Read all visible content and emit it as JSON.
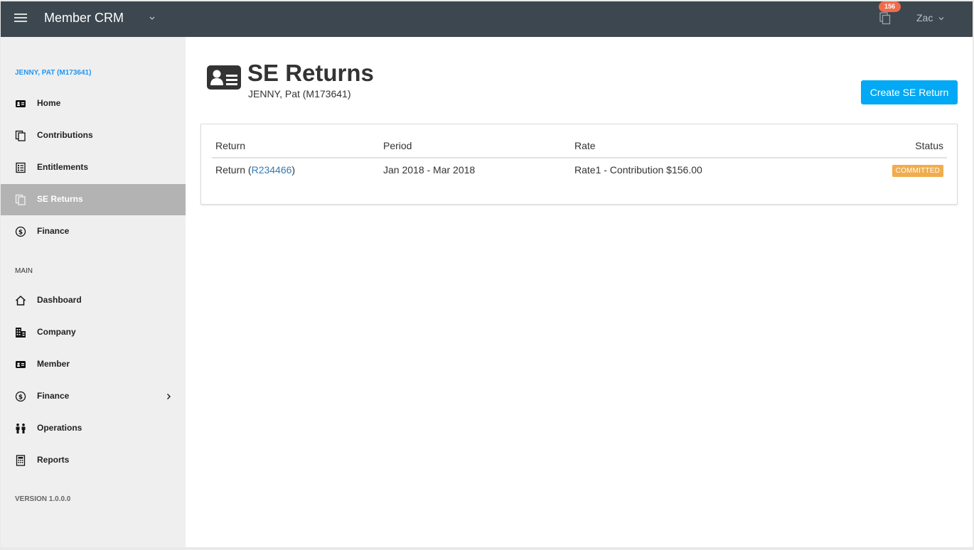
{
  "app": {
    "title": "Member CRM",
    "notification_count": "156",
    "user_name": "Zac"
  },
  "sidebar": {
    "member_label": "JENNY, PAT (M173641)",
    "member_items": [
      {
        "label": "Home",
        "icon": "id-card-icon"
      },
      {
        "label": "Contributions",
        "icon": "copy-icon"
      },
      {
        "label": "Entitlements",
        "icon": "checklist-icon"
      },
      {
        "label": "SE Returns",
        "icon": "copy-icon",
        "active": true
      },
      {
        "label": "Finance",
        "icon": "dollar-circle-icon"
      }
    ],
    "section_label": "MAIN",
    "main_items": [
      {
        "label": "Dashboard",
        "icon": "home-icon"
      },
      {
        "label": "Company",
        "icon": "building-icon"
      },
      {
        "label": "Member",
        "icon": "id-card-icon"
      },
      {
        "label": "Finance",
        "icon": "dollar-circle-icon",
        "has_submenu": true
      },
      {
        "label": "Operations",
        "icon": "people-icon"
      },
      {
        "label": "Reports",
        "icon": "calculator-icon"
      }
    ],
    "version": "VERSION 1.0.0.0"
  },
  "page": {
    "title": "SE Returns",
    "subtitle": "JENNY, Pat (M173641)",
    "create_button_label": "Create SE Return"
  },
  "table": {
    "headers": {
      "return": "Return",
      "period": "Period",
      "rate": "Rate",
      "status": "Status"
    },
    "rows": [
      {
        "return_prefix": "Return (",
        "return_id": "R234466",
        "return_suffix": ")",
        "period": "Jan 2018 - Mar 2018",
        "rate": "Rate1 - Contribution $156.00",
        "status": "COMMITTED"
      }
    ]
  },
  "colors": {
    "topbar": "#3c474f",
    "accent": "#03a9f4",
    "link": "#337ab7",
    "status_committed": "#f0ad4e",
    "notification": "#ef6c4c",
    "sidebar_active": "#b3b3b3"
  }
}
